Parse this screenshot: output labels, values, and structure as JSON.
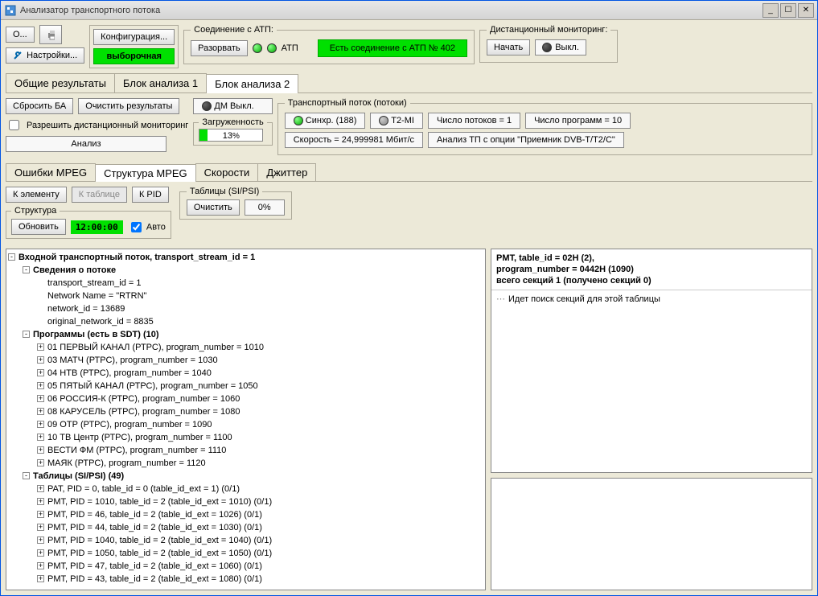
{
  "window": {
    "title": "Анализатор транспортного потока"
  },
  "toolbar": {
    "open": "О...",
    "print": "",
    "settings": "Настройки...",
    "configuration": "Конфигурация...",
    "mode": "выборочная"
  },
  "connection": {
    "legend": "Соединение с АТП:",
    "disconnect": "Разорвать",
    "atp": "АТП",
    "status": "Есть соединение с АТП № 402"
  },
  "remote": {
    "legend": "Дистанционный мониторинг:",
    "start": "Начать",
    "off": "Выкл."
  },
  "mainTabs": [
    "Общие результаты",
    "Блок анализа 1",
    "Блок анализа 2"
  ],
  "mainTabActive": 2,
  "controls": {
    "resetBA": "Сбросить БА",
    "clearResults": "Очистить результаты",
    "dmOff": "ДМ Выкл.",
    "allowRemote": "Разрешить дистанционный мониторинг",
    "analysis": "Анализ",
    "loadLabel": "Загруженность",
    "loadPercent": 13
  },
  "tstream": {
    "legend": "Транспортный поток (потоки)",
    "sync": "Синхр. (188)",
    "t2mi": "T2-MI",
    "streams": "Число потоков = 1",
    "programs": "Число программ = 10",
    "speed": "Скорость = 24,999981 Мбит/с",
    "analysisFrom": "Анализ ТП с опции \"Приемник DVB-T/T2/C\""
  },
  "subTabs": [
    "Ошибки MPEG",
    "Структура MPEG",
    "Скорости",
    "Джиттер"
  ],
  "subTabActive": 1,
  "struct": {
    "toElement": "К элементу",
    "toTable": "К таблице",
    "toPID": "К PID",
    "structLegend": "Структура",
    "update": "Обновить",
    "time": "12:00:00",
    "auto": "Авто",
    "tablesLegend": "Таблицы (SI/PSI)",
    "clear": "Очистить",
    "tablesPercent": "0%"
  },
  "tree": {
    "root": "Входной транспортный поток, transport_stream_id = 1",
    "streamInfo": "Сведения о потоке",
    "streamDetails": [
      "transport_stream_id = 1",
      "Network Name = \"RTRN\"",
      "network_id = 13689",
      "original_network_id = 8835"
    ],
    "programs": "Программы (есть в SDT) (10)",
    "programsList": [
      "01 ПЕРВЫЙ КАНАЛ (РТРС), program_number = 1010",
      "03 МАТЧ (РТРС), program_number = 1030",
      "04 НТВ (РТРС), program_number = 1040",
      "05 ПЯТЫЙ КАНАЛ (РТРС), program_number = 1050",
      "06 РОССИЯ-К (РТРС), program_number = 1060",
      "08 КАРУСЕЛЬ (РТРС), program_number = 1080",
      "09 ОТР (РТРС), program_number = 1090",
      "10 ТВ Центр (РТРС), program_number = 1100",
      "ВЕСТИ ФМ (РТРС), program_number = 1110",
      "МАЯК (РТРС), program_number = 1120"
    ],
    "tables": "Таблицы (SI/PSI) (49)",
    "tablesList": [
      "PAT, PID = 0, table_id = 0 (table_id_ext = 1) (0/1)",
      "PMT, PID = 1010, table_id = 2 (table_id_ext = 1010) (0/1)",
      "PMT, PID = 46, table_id = 2 (table_id_ext = 1026) (0/1)",
      "PMT, PID = 44, table_id = 2 (table_id_ext = 1030) (0/1)",
      "PMT, PID = 1040, table_id = 2 (table_id_ext = 1040) (0/1)",
      "PMT, PID = 1050, table_id = 2 (table_id_ext = 1050) (0/1)",
      "PMT, PID = 47, table_id = 2 (table_id_ext = 1060) (0/1)",
      "PMT, PID = 43, table_id = 2 (table_id_ext = 1080) (0/1)"
    ]
  },
  "detail": {
    "line1": "PMT, table_id = 02H (2),",
    "line2": "program_number = 0442H (1090)",
    "line3": "всего секций 1 (получено секций 0)",
    "searching": "Идет поиск секций для этой таблицы"
  }
}
